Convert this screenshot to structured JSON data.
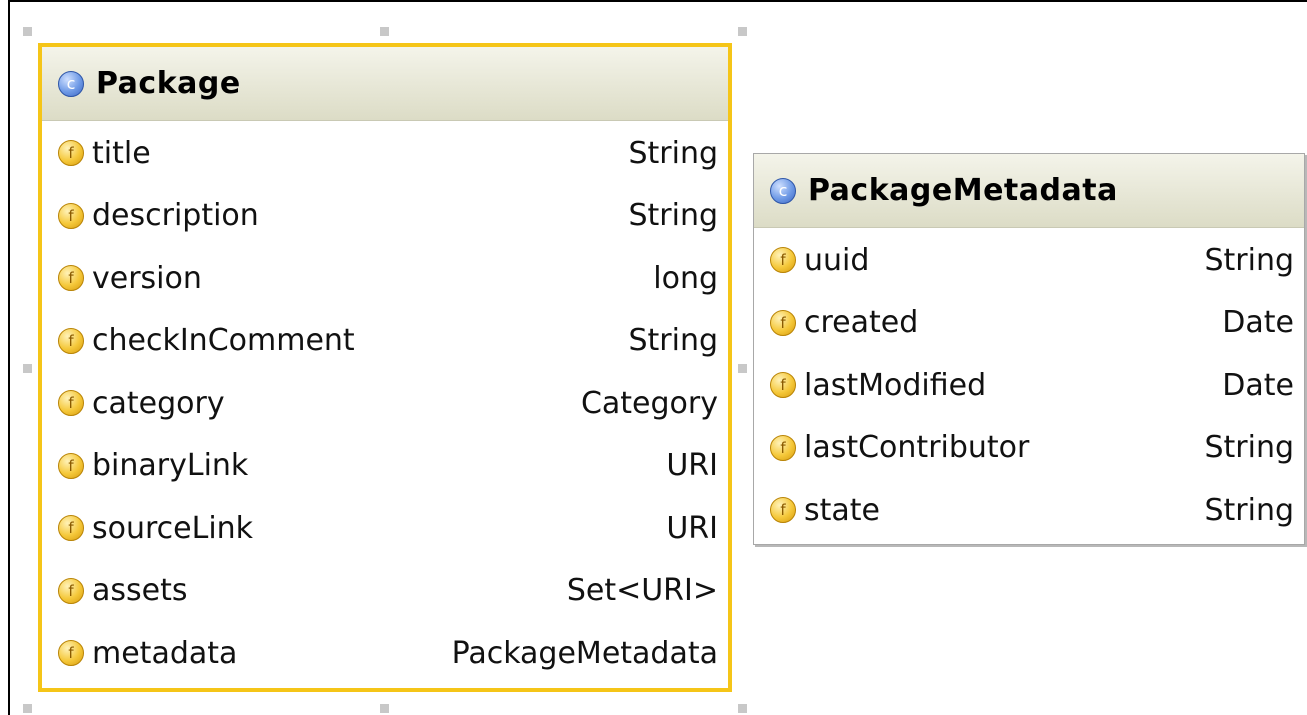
{
  "classes": [
    {
      "id": "package",
      "kind_icon": "class-icon",
      "name": "Package",
      "selected": true,
      "fields": [
        {
          "name": "title",
          "type": "String"
        },
        {
          "name": "description",
          "type": "String"
        },
        {
          "name": "version",
          "type": "long"
        },
        {
          "name": "checkInComment",
          "type": "String"
        },
        {
          "name": "category",
          "type": "Category"
        },
        {
          "name": "binaryLink",
          "type": "URI"
        },
        {
          "name": "sourceLink",
          "type": "URI"
        },
        {
          "name": "assets",
          "type": "Set<URI>"
        },
        {
          "name": "metadata",
          "type": "PackageMetadata"
        }
      ]
    },
    {
      "id": "package-metadata",
      "kind_icon": "class-icon",
      "name": "PackageMetadata",
      "selected": false,
      "fields": [
        {
          "name": "uuid",
          "type": "String"
        },
        {
          "name": "created",
          "type": "Date"
        },
        {
          "name": "lastModified",
          "type": "Date"
        },
        {
          "name": "lastContributor",
          "type": "String"
        },
        {
          "name": "state",
          "type": "String"
        }
      ]
    }
  ],
  "icons": {
    "class_glyph": "c",
    "field_glyph": "f"
  },
  "colors": {
    "selection_border": "#f5c518",
    "header_gradient_top": "#f4f4ea",
    "header_gradient_bottom": "#dcdcc6",
    "class_icon": "#6f9ae6",
    "field_icon": "#f5c83a"
  }
}
